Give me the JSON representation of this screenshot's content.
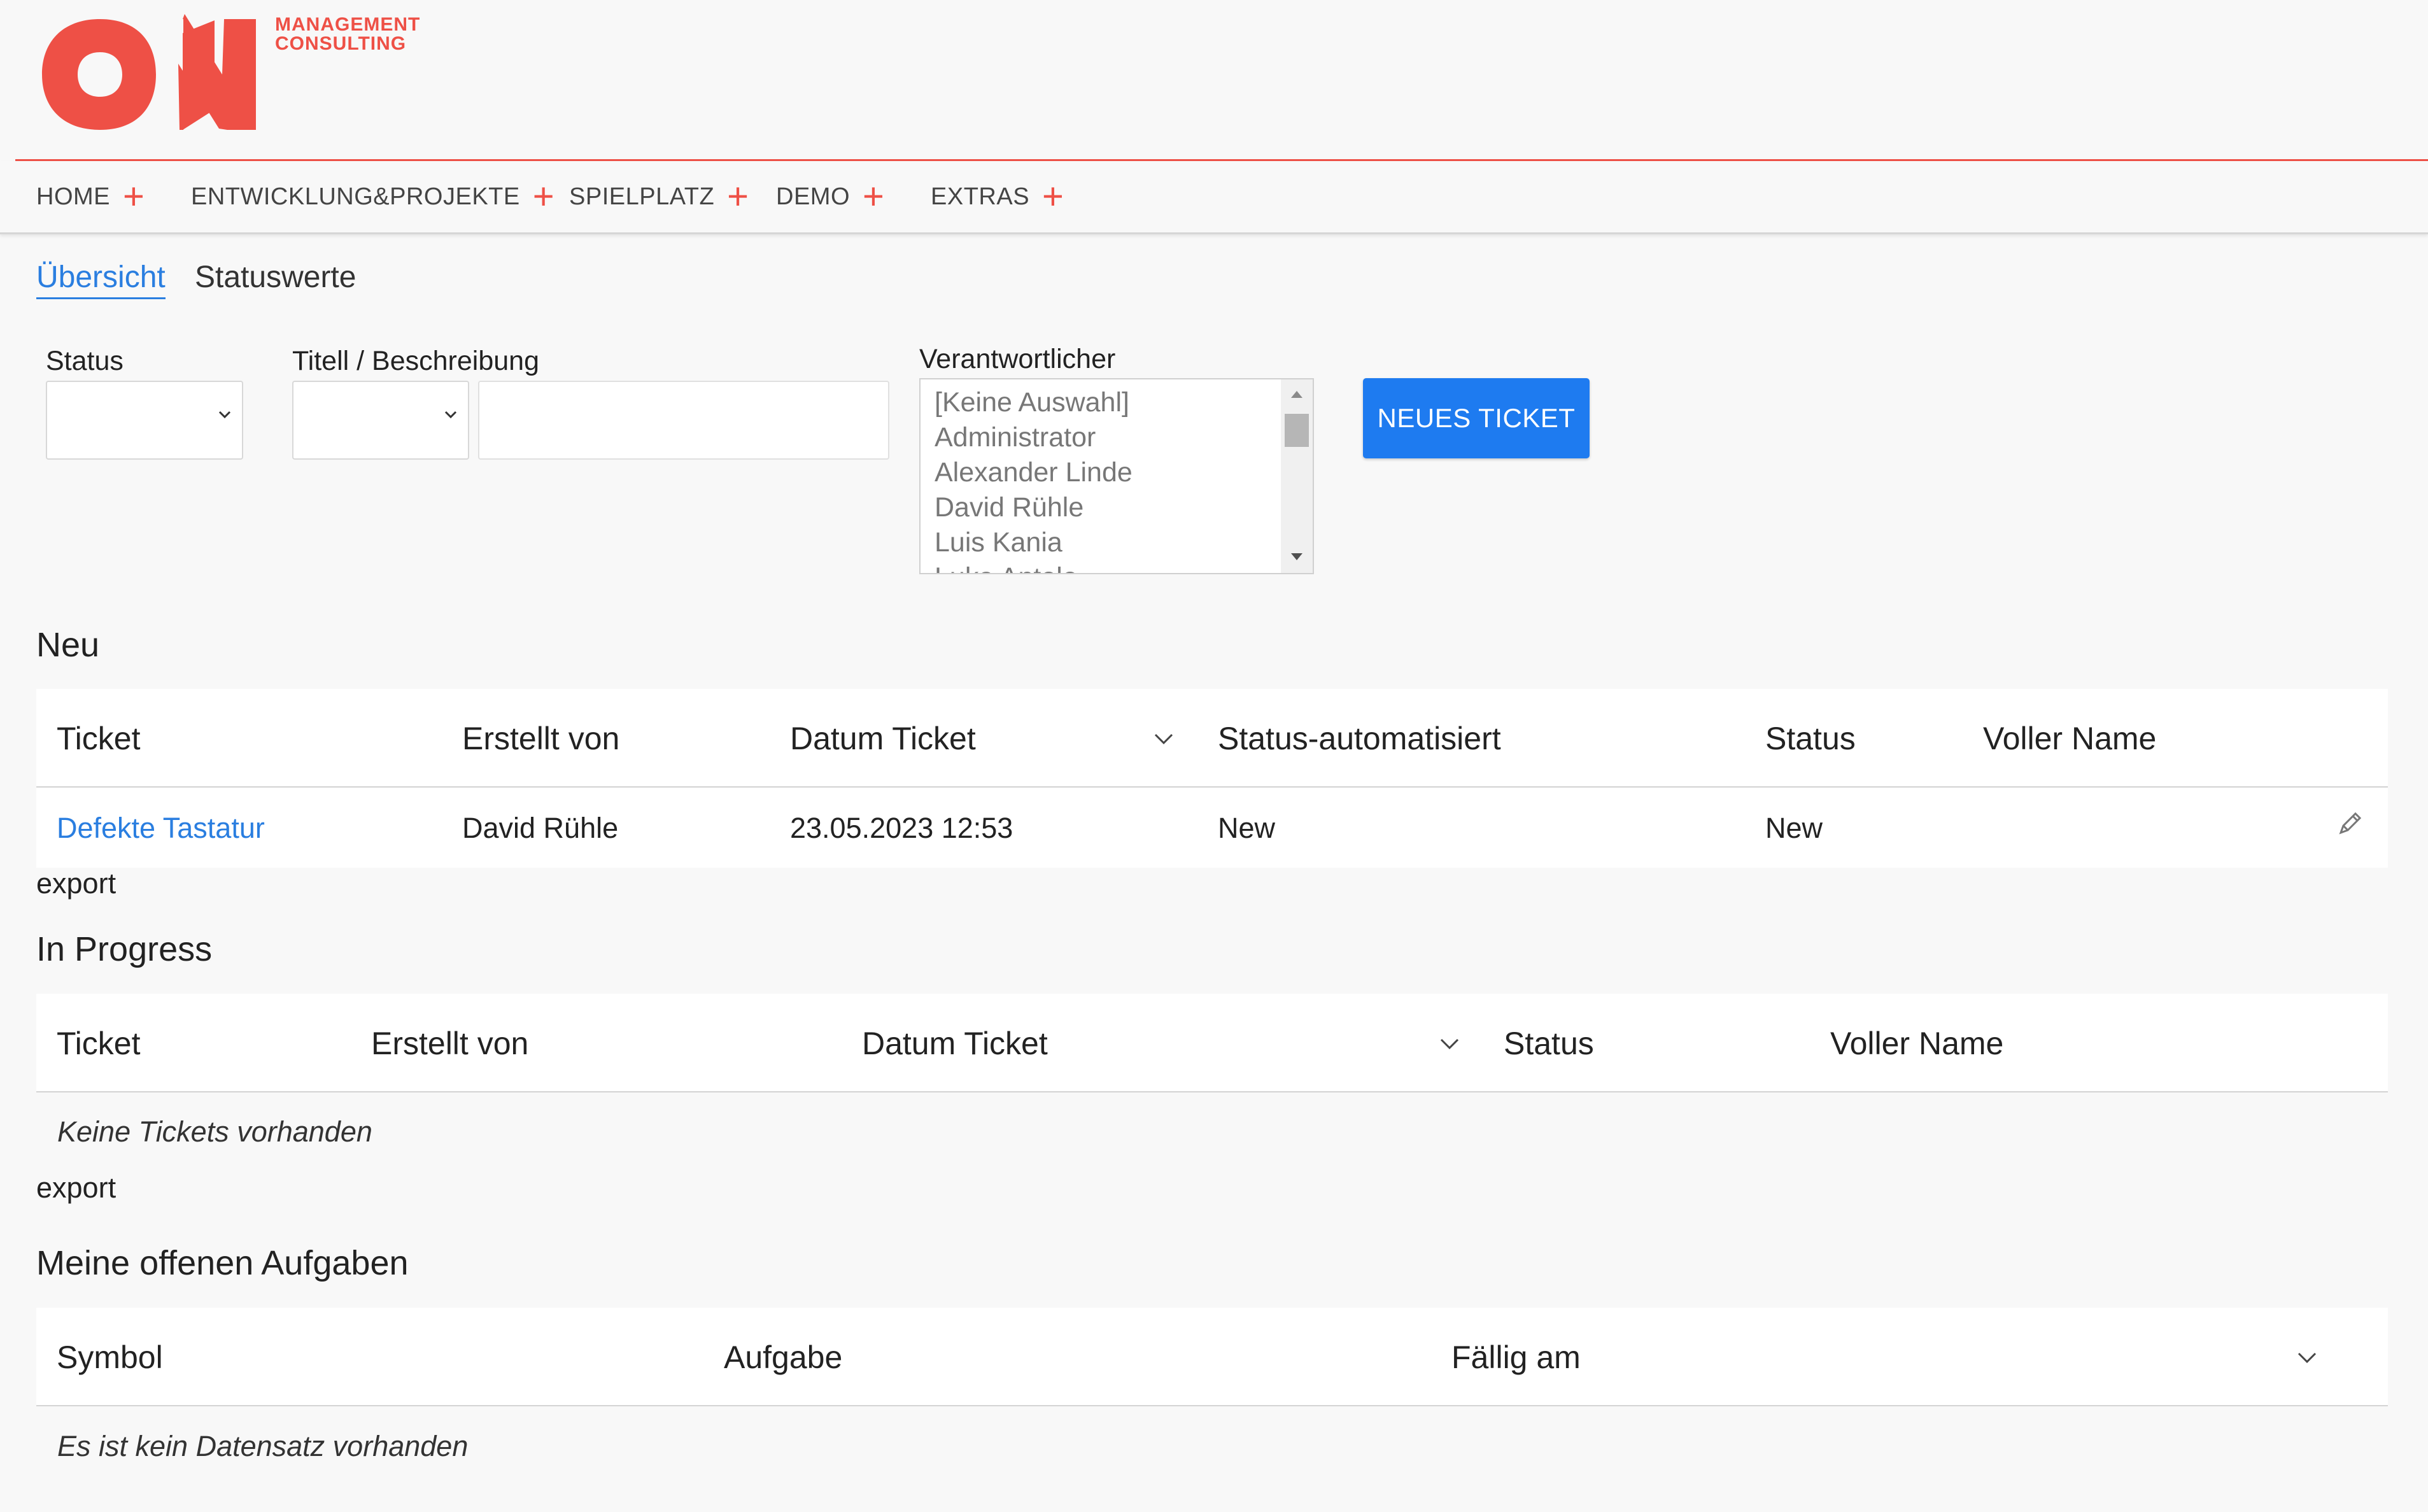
{
  "brand": {
    "logo_text": "ON",
    "sub_line1": "MANAGEMENT",
    "sub_line2": "CONSULTING",
    "color": "#ee5046"
  },
  "nav": {
    "items": [
      {
        "label": "HOME"
      },
      {
        "label": "ENTWICKLUNG&PROJEKTE"
      },
      {
        "label": "SPIELPLATZ"
      },
      {
        "label": "DEMO"
      },
      {
        "label": "EXTRAS"
      }
    ],
    "plus_icon": "plus-icon"
  },
  "tabs": [
    {
      "label": "Übersicht",
      "active": true
    },
    {
      "label": "Statuswerte",
      "active": false
    }
  ],
  "filters": {
    "status_label": "Status",
    "status_value": "",
    "title_label": "Titell / Beschreibung",
    "title_select_value": "",
    "title_input_value": "",
    "responsible_label": "Verantwortlicher",
    "responsible_options": [
      "[Keine Auswahl]",
      "Administrator",
      "Alexander Linde",
      "David Rühle",
      "Luis Kania",
      "Luka Antolo"
    ],
    "new_ticket_label": "NEUES TICKET",
    "accent": "#1e7bf0"
  },
  "sections": {
    "neu": {
      "title": "Neu",
      "columns": [
        "Ticket",
        "Erstellt von",
        "Datum Ticket",
        "Status-automatisiert",
        "Status",
        "Voller Name"
      ],
      "rows": [
        {
          "ticket": "Defekte Tastatur",
          "created_by": "David Rühle",
          "date": "23.05.2023 12:53",
          "status_auto": "New",
          "status": "New",
          "full_name": ""
        }
      ],
      "export_label": "export"
    },
    "in_progress": {
      "title": "In Progress",
      "columns": [
        "Ticket",
        "Erstellt von",
        "Datum Ticket",
        "Status",
        "Voller Name"
      ],
      "empty_message": "Keine Tickets vorhanden",
      "export_label": "export"
    },
    "tasks": {
      "title": "Meine offenen Aufgaben",
      "columns": [
        "Symbol",
        "Aufgabe",
        "Fällig am"
      ],
      "empty_message": "Es ist kein Datensatz vorhanden"
    }
  }
}
